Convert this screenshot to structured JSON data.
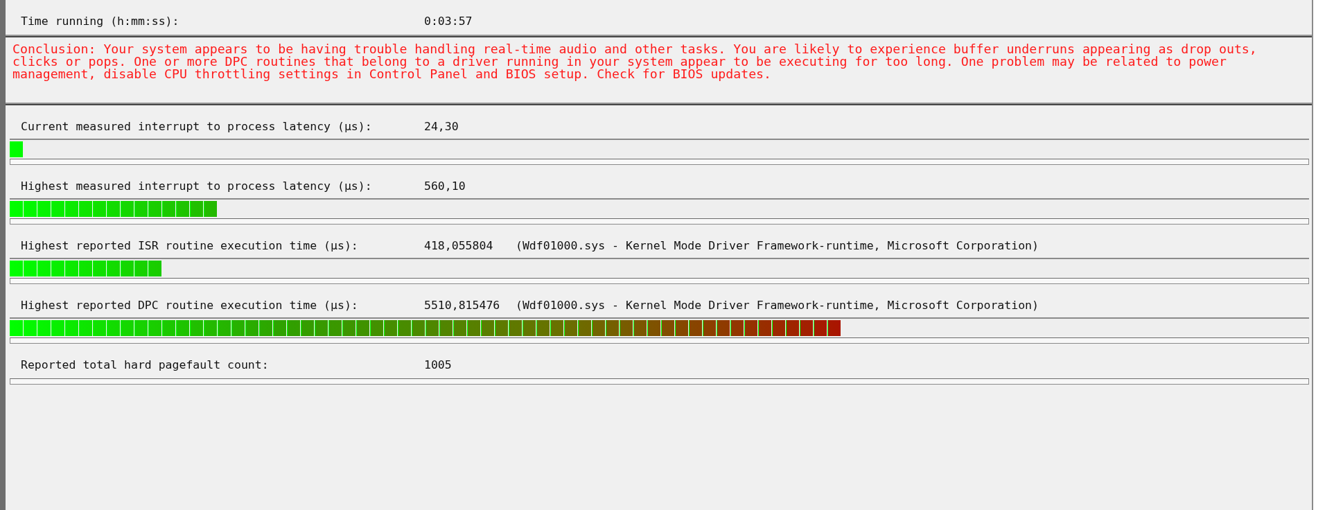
{
  "status": {
    "label": "Time running (h:mm:ss):",
    "value": "0:03:57"
  },
  "conclusion": "Conclusion: Your system appears to be having trouble handling real-time audio and other tasks. You are likely to experience buffer underruns appearing as drop outs, clicks or pops. One or more DPC routines that belong to a driver running in your system appear to be executing for too long. One problem may be related to power management, disable CPU throttling settings in Control Panel and BIOS setup. Check for BIOS updates.",
  "meters": [
    {
      "kind": "bar",
      "label": "Current measured interrupt to process latency (µs):",
      "value": "24,30",
      "level": 0.011
    },
    {
      "kind": "bar",
      "label": "Highest measured interrupt to process latency (µs):",
      "value": "560,10",
      "level": 0.16
    },
    {
      "kind": "bar",
      "label": "Highest reported ISR routine execution time (µs):",
      "value": "418,055804",
      "driver": "(Wdf01000.sys - Kernel Mode Driver Framework-runtime, Microsoft Corporation)",
      "level": 0.117
    },
    {
      "kind": "bar",
      "label": "Highest reported DPC routine execution time (µs):",
      "value": "5510,815476",
      "driver": "(Wdf01000.sys - Kernel Mode Driver Framework-runtime, Microsoft Corporation)",
      "level": 0.64
    },
    {
      "kind": "count",
      "label": "Reported total hard pagefault count:",
      "value": "1005"
    }
  ]
}
